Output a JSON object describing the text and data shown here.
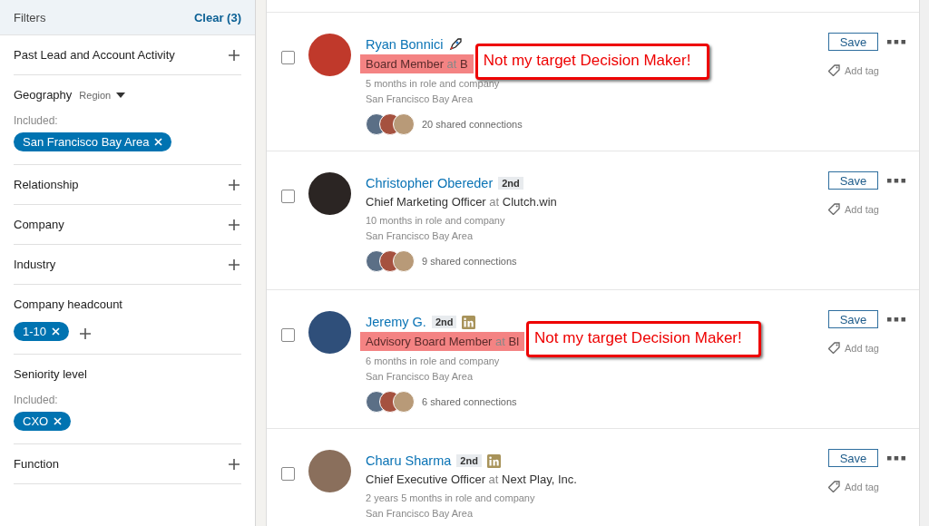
{
  "filters": {
    "title": "Filters",
    "clear": "Clear (3)",
    "sections": [
      {
        "kind": "collapsed",
        "label": "Past Lead and Account Activity"
      },
      {
        "kind": "picked",
        "label": "Geography",
        "dropdown": "Region",
        "included": "Included:",
        "pills": [
          "San Francisco Bay Area"
        ]
      },
      {
        "kind": "collapsed",
        "label": "Relationship"
      },
      {
        "kind": "collapsed",
        "label": "Company"
      },
      {
        "kind": "collapsed",
        "label": "Industry"
      },
      {
        "kind": "picked",
        "label": "Company headcount",
        "pills": [
          "1-10"
        ],
        "add": true
      },
      {
        "kind": "picked",
        "label": "Seniority level",
        "included": "Included:",
        "pills": [
          "CXO"
        ]
      },
      {
        "kind": "collapsed",
        "label": "Function"
      }
    ]
  },
  "leads": [
    {
      "name": "Ryan Bonnici",
      "rocket": true,
      "premium": false,
      "title": "Board Member at B",
      "highlighted": true,
      "callout": "Not my target Decision Maker!",
      "tenure": "5 months in role and company",
      "location": "San Francisco Bay Area",
      "connections": "20 shared connections",
      "checked": false,
      "save": "Save",
      "tag": "Add tag"
    },
    {
      "name": "Christopher Obereder",
      "degree": "2nd",
      "rocket": false,
      "premium": false,
      "title": "Chief Marketing Officer at Clutch.win",
      "highlighted": false,
      "tenure": "10 months in role and company",
      "location": "San Francisco Bay Area",
      "connections": "9 shared connections",
      "checked": false,
      "save": "Save",
      "tag": "Add tag"
    },
    {
      "name": "Jeremy G.",
      "degree": "2nd",
      "rocket": false,
      "premium": true,
      "title": "Advisory Board Member at Bl",
      "highlighted": true,
      "callout": "Not my target Decision Maker!",
      "tenure": "6 months in role and company",
      "location": "San Francisco Bay Area",
      "connections": "6 shared connections",
      "checked": false,
      "save": "Save",
      "tag": "Add tag"
    },
    {
      "name": "Charu Sharma",
      "degree": "2nd",
      "rocket": false,
      "premium": true,
      "title": "Chief Executive Officer at Next Play, Inc.",
      "highlighted": false,
      "tenure": "2 years 5 months in role and company",
      "location": "San Francisco Bay Area",
      "checked": false,
      "save": "Save",
      "tag": "Add tag"
    }
  ]
}
